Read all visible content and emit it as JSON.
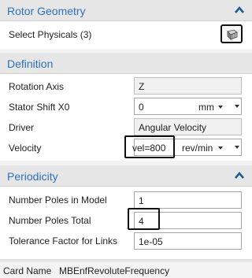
{
  "sections": {
    "rotor_geometry": {
      "title": "Rotor Geometry",
      "select_physicals_label": "Select Physicals (3)"
    },
    "definition": {
      "title": "Definition",
      "rotation_axis": {
        "label": "Rotation Axis",
        "value": "Z"
      },
      "stator_shift": {
        "label": "Stator Shift X0",
        "value": "0",
        "unit": "mm"
      },
      "driver": {
        "label": "Driver",
        "value": "Angular Velocity"
      },
      "velocity": {
        "label": "Velocity",
        "value": "vel=800",
        "unit": "rev/min"
      }
    },
    "periodicity": {
      "title": "Periodicity",
      "poles_in_model": {
        "label": "Number Poles in Model",
        "value": "1"
      },
      "poles_total": {
        "label": "Number Poles Total",
        "value": "4"
      },
      "tolerance": {
        "label": "Tolerance Factor for Links",
        "value": "1e-05"
      }
    }
  },
  "footer": {
    "card_name_label": "Card Name",
    "card_name_value": "MBEnfRevoluteFrequency"
  },
  "icons": {
    "collapse": "chevron-up-icon",
    "pick": "select-geometry-icon"
  },
  "colors": {
    "section_title": "#2c72b8",
    "chevron": "#1f5f99"
  }
}
